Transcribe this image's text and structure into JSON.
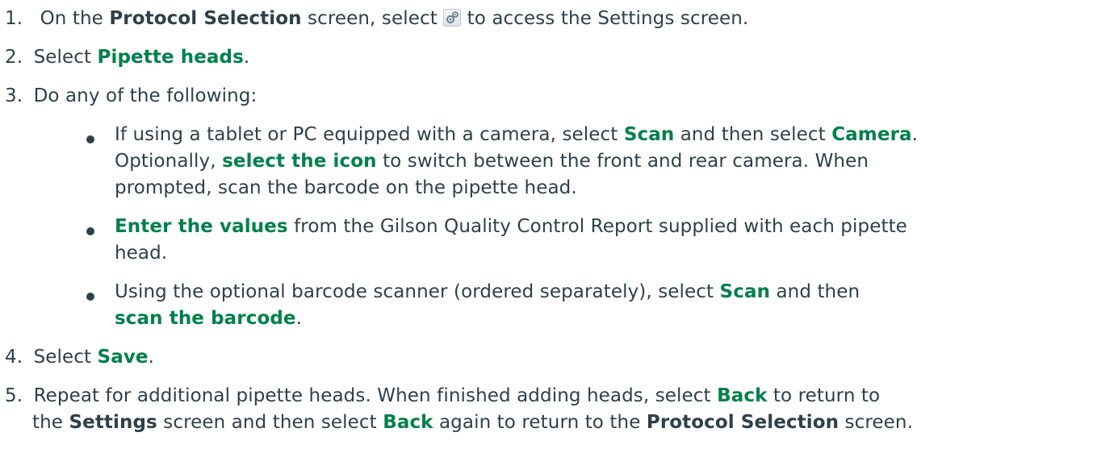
{
  "steps": [
    {
      "num": "1.",
      "pre": "On the ",
      "bold1": "Protocol Selection",
      "mid": " screen, select ",
      "icon": "settings-gears-icon",
      "post": " to access the Settings screen."
    },
    {
      "num": "2.",
      "pre": "Select ",
      "link": "Pipette heads",
      "post": "."
    },
    {
      "num": "3.",
      "text": "Do any of the following:"
    },
    {
      "num": "4.",
      "pre": "Select ",
      "link": "Save",
      "post": "."
    },
    {
      "num": "5.",
      "l1_pre": "Repeat for additional pipette heads. When finished adding heads, select ",
      "l1_link": "Back",
      "l1_post": " to return to",
      "l2_pre": "the ",
      "l2_bold1": "Settings",
      "l2_mid1": " screen and then select ",
      "l2_link": "Back",
      "l2_mid2": " again to return to the ",
      "l2_bold2": "Protocol Selection",
      "l2_post": " screen."
    }
  ],
  "bullets": [
    {
      "l1_pre": "If using a tablet or PC equipped with a camera, select ",
      "l1_link1": "Scan",
      "l1_mid": " and then select ",
      "l1_link2": "Camera",
      "l1_post": ".",
      "l2_pre": "Optionally, ",
      "l2_link": "select the icon",
      "l2_post": " to switch between the front and rear camera. When",
      "l3": "prompted, scan the barcode on the pipette head."
    },
    {
      "l1_link": "Enter the values",
      "l1_post": " from the Gilson Quality Control Report supplied with each pipette",
      "l2": "head."
    },
    {
      "l1_pre": "Using the optional barcode scanner (ordered separately), select ",
      "l1_link": "Scan",
      "l1_post": " and then",
      "l2_link": "scan the barcode",
      "l2_post": "."
    }
  ],
  "colors": {
    "text": "#2e4049",
    "link": "#00804a"
  }
}
